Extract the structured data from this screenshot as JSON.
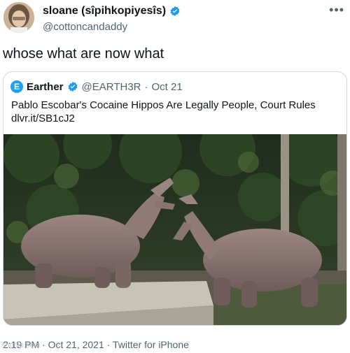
{
  "tweet": {
    "display_name": "sloane (sîpihkopiyesîs)",
    "handle": "@cottoncandaddy",
    "text": "whose what are now what",
    "timestamp": "2:19 PM",
    "date": "Oct 21, 2021",
    "source": "Twitter for iPhone",
    "separator": "·",
    "more_icon": "more-horizontal-icon"
  },
  "quoted_tweet": {
    "avatar_letter": "E",
    "display_name": "Earther",
    "handle": "@EARTH3R",
    "date": "Oct 21",
    "separator": "·",
    "text_line1": "Pablo Escobar's Cocaine Hippos Are Legally People, Court Rules",
    "text_line2": "dlvr.it/SB1cJ2"
  },
  "watermark": "imgflip.com",
  "colors": {
    "verified": "#1d9bf0",
    "secondary_text": "#536471",
    "border": "#cfd9de"
  }
}
